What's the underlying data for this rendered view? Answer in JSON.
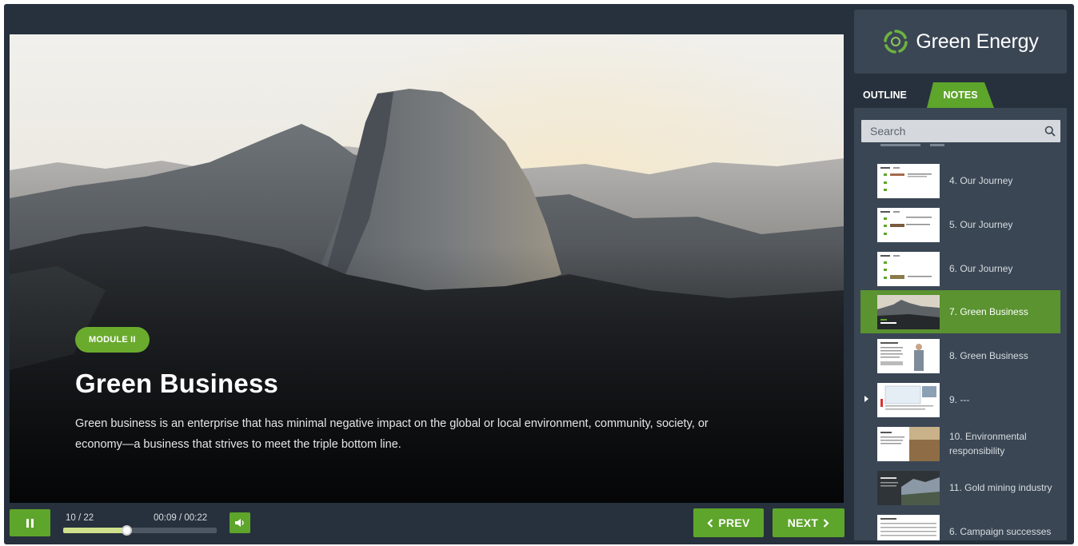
{
  "slide": {
    "module_badge": "MODULE II",
    "title": "Green Business",
    "description": "Green business is an enterprise that has minimal negative impact on the global or local environment, community, society, or economy—a business that strives to meet the triple bottom line."
  },
  "player": {
    "slide_counter": "10 / 22",
    "time_current": "00:09",
    "time_total": "00:22",
    "time_separator": " / ",
    "progress": 0.41,
    "prev_label": "PREV",
    "next_label": "NEXT"
  },
  "sidebar": {
    "logo_text": "Green Energy",
    "tabs": [
      {
        "label": "OUTLINE",
        "active": false
      },
      {
        "label": "NOTES",
        "active": true
      }
    ],
    "search_placeholder": "Search",
    "items": [
      {
        "label": "4. Our Journey",
        "thumb": "text-slide",
        "active": false
      },
      {
        "label": "5. Our Journey",
        "thumb": "text-slide",
        "active": false
      },
      {
        "label": "6. Our Journey",
        "thumb": "text-slide",
        "active": false
      },
      {
        "label": "7. Green Business",
        "thumb": "mountain-slide",
        "active": true
      },
      {
        "label": "8. Green Business",
        "thumb": "presenter-slide",
        "active": false
      },
      {
        "label": "9. ---",
        "thumb": "screenshot-slide",
        "active": false,
        "expandable": true
      },
      {
        "label": "10. Environmental responsibility",
        "thumb": "field-slide",
        "active": false
      },
      {
        "label": "11. Gold mining industry",
        "thumb": "landscape-slide",
        "active": false
      },
      {
        "label": "6. Campaign successes",
        "thumb": "table-slide",
        "active": false
      }
    ]
  },
  "colors": {
    "accent_green": "#5ea52b",
    "frame_bg": "#27313d",
    "panel_bg": "#3a4654"
  }
}
